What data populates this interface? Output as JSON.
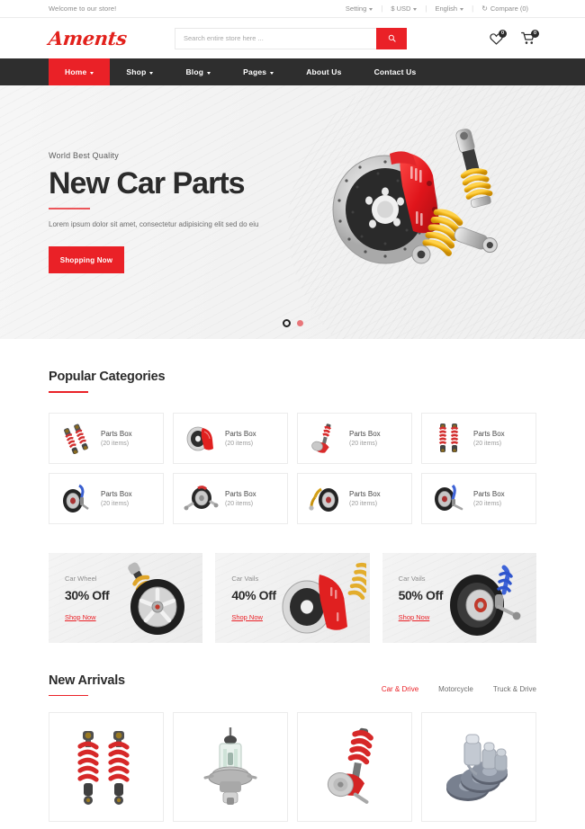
{
  "topbar": {
    "welcome": "Welcome to our store!",
    "items": [
      {
        "label": "Setting",
        "icon": "chevron-down-icon",
        "has_caret": true
      },
      {
        "label": "$ USD",
        "icon": "chevron-down-icon",
        "has_caret": true
      },
      {
        "label": "English",
        "icon": "chevron-down-icon",
        "has_caret": true
      },
      {
        "label": "Compare (0)",
        "icon": "compare-icon",
        "has_caret": false
      }
    ],
    "separator": "|"
  },
  "header": {
    "logo": "Aments",
    "search": {
      "placeholder": "Search entire store here ...",
      "value": "",
      "icon": "search-icon"
    },
    "wishlist": {
      "icon": "heart-icon",
      "count": "0"
    },
    "cart": {
      "icon": "cart-icon",
      "count": "0"
    }
  },
  "nav": {
    "items": [
      {
        "label": "Home",
        "active": true,
        "caret": true
      },
      {
        "label": "Shop",
        "active": false,
        "caret": true
      },
      {
        "label": "Blog",
        "active": false,
        "caret": true
      },
      {
        "label": "Pages",
        "active": false,
        "caret": true
      },
      {
        "label": "About Us",
        "active": false,
        "caret": false
      },
      {
        "label": "Contact Us",
        "active": false,
        "caret": false
      }
    ]
  },
  "hero": {
    "eyebrow": "World Best Quality",
    "title": "New Car Parts",
    "subtitle": "Lorem ipsum dolor sit amet, consectetur adipisicing elit sed do eiu",
    "cta": "Shopping Now",
    "artwork": "brake-disc-coilover-image",
    "dots": [
      {
        "state": "active",
        "style": "ring"
      },
      {
        "state": "inactive",
        "style": "fill"
      }
    ]
  },
  "categories": {
    "title": "Popular Categories",
    "items": [
      {
        "name": "Parts Box",
        "count": "(20 items)",
        "thumb": "twin-shock-absorber-red"
      },
      {
        "name": "Parts Box",
        "count": "(20 items)",
        "thumb": "brake-disc-red-caliper"
      },
      {
        "name": "Parts Box",
        "count": "(20 items)",
        "thumb": "red-strut-assembly"
      },
      {
        "name": "Parts Box",
        "count": "(20 items)",
        "thumb": "twin-coil-shock-red"
      },
      {
        "name": "Parts Box",
        "count": "(20 items)",
        "thumb": "wheel-blue-strut"
      },
      {
        "name": "Parts Box",
        "count": "(20 items)",
        "thumb": "wheel-axle-assembly"
      },
      {
        "name": "Parts Box",
        "count": "(20 items)",
        "thumb": "wheel-gold-shock"
      },
      {
        "name": "Parts Box",
        "count": "(20 items)",
        "thumb": "wheel-blue-suspension"
      }
    ]
  },
  "promos": [
    {
      "kicker": "Car Wheel",
      "offer": "30% Off",
      "link": "Shop Now",
      "artwork": "alloy-wheel-gold-coilover"
    },
    {
      "kicker": "Car Vails",
      "offer": "40% Off",
      "link": "Shop Now",
      "artwork": "brake-disc-red-caliper-spring"
    },
    {
      "kicker": "Car Vails",
      "offer": "50% Off",
      "link": "Shop Now",
      "artwork": "tyre-blue-coilover"
    }
  ],
  "new_arrivals": {
    "title": "New Arrivals",
    "tabs": [
      {
        "label": "Car & Drive",
        "active": true
      },
      {
        "label": "Motorcycle",
        "active": false
      },
      {
        "label": "Truck & Drive",
        "active": false
      }
    ],
    "products": [
      {
        "image": "twin-red-coil-springs"
      },
      {
        "image": "halogen-headlight-bulb"
      },
      {
        "image": "red-strut-brake-assembly"
      },
      {
        "image": "stacked-brake-discs-calipers"
      }
    ]
  },
  "colors": {
    "accent_red": "#ea2127",
    "nav_dark": "#2e2e2e",
    "heading": "#2b2b2b",
    "muted_text": "#8d8d8d",
    "border": "#ececec",
    "hero_bg": "#f2f2f2"
  }
}
